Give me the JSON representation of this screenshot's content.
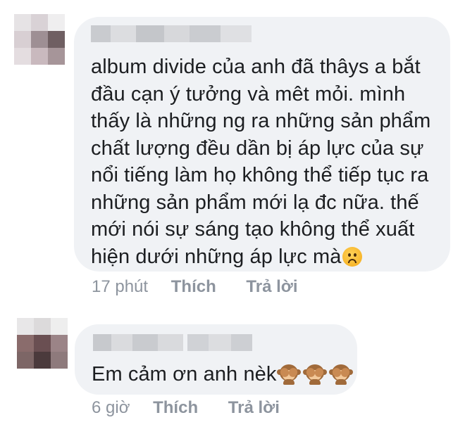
{
  "comments": [
    {
      "author_redacted": "",
      "text": "album divide của anh đã thâys a bắt\nđầu cạn ý tưởng và mêt mỏi. mình\nthấy là những ng ra những sản phẩm\nchất lượng đều dần bị áp lực của sự\nnổi tiếng làm họ không thể tiếp tục ra\nnhững sản phẩm mới lạ đc nữa. thế\nmới nói sự sáng tạo không thể xuất\nhiện dưới những áp lực mà",
      "emoji": "sad-face-emoji",
      "time": "17 phút",
      "like_label": "Thích",
      "reply_label": "Trả lời"
    },
    {
      "author_redacted": "",
      "text": "Em cảm ơn anh nèk",
      "emoji": "see-no-evil-monkey-emoji",
      "emoji_count": 3,
      "time": "6 giờ",
      "like_label": "Thích",
      "reply_label": "Trả lời"
    }
  ],
  "colors": {
    "bubble": "#f0f2f5",
    "meta_text": "#8d949e",
    "text": "#1c1e21"
  }
}
